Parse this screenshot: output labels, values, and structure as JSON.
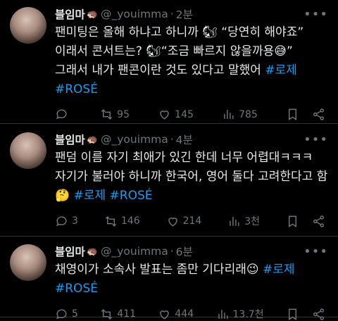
{
  "tweets": [
    {
      "name": "블임마",
      "name_emoji": "🦔",
      "handle": "@_youimma",
      "dot": "·",
      "time": "2분",
      "lines": [
        "팬미팅은 올해 하냐고 하니까 🐿 “당연히 해야죠”",
        "이래서 콘서트는? 🐿“조금 빠르지 않을까용😅”",
        "그래서 내가 팬콘이란 것도 있다고 말했어 "
      ],
      "tags": [
        "#로제",
        "#ROSÉ"
      ],
      "reply": "",
      "retweet": "95",
      "like": "145",
      "views": "785"
    },
    {
      "name": "블임마",
      "name_emoji": "🦔",
      "handle": "@_youimma",
      "dot": "·",
      "time": "4분",
      "lines": [
        "팬덤 이름 자기 최애가 있긴 한데 너무 어렵대ㅋㅋㅋ",
        "자기가 불러야 하니까 한국어, 영어 둘다 고려한다고 함",
        "🤔 "
      ],
      "tags": [
        "#로제",
        "#ROSÉ"
      ],
      "reply": "3",
      "retweet": "146",
      "like": "214",
      "views": "3천"
    },
    {
      "name": "블임마",
      "name_emoji": "🦔",
      "handle": "@_youimma",
      "dot": "·",
      "time": "6분",
      "lines": [
        "채영이가 소속사 발표는 좀만 기다리래😉 "
      ],
      "tags": [
        "#로제",
        "#ROSÉ"
      ],
      "reply": "5",
      "retweet": "411",
      "like": "444",
      "views": "13.7천"
    }
  ],
  "icons": {
    "more": "more-dots-icon",
    "reply": "reply-bubble-icon",
    "retweet": "retweet-icon",
    "like": "heart-icon",
    "views": "views-bars-icon",
    "bookmark": "bookmark-icon",
    "share": "share-icon"
  },
  "colors": {
    "background": "#000000",
    "text": "#e7e9ea",
    "muted": "#71767b",
    "link": "#1d9bf0",
    "divider": "#2f3336"
  }
}
